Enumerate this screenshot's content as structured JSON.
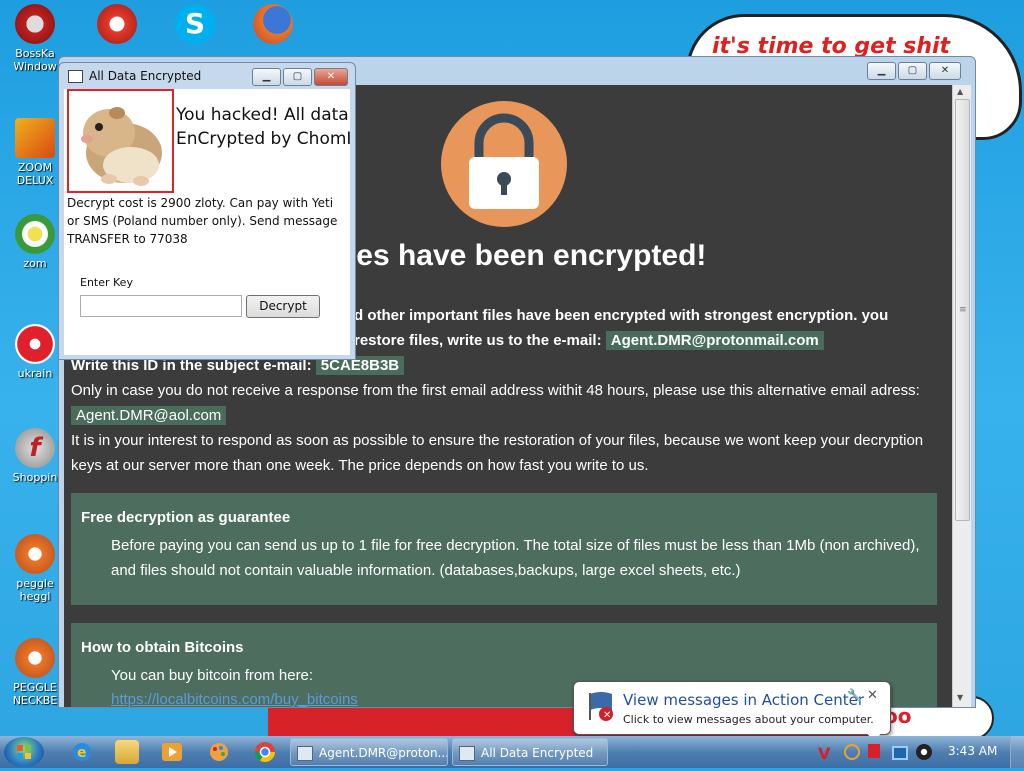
{
  "desktop": {
    "wallpaper_text": "it's time to get shit",
    "wallpaper_text2": "oo",
    "icons": [
      {
        "label_line1": "BossKa",
        "label_line2": "Window"
      },
      {
        "label_line1": "ZOOM",
        "label_line2": "DELUX"
      },
      {
        "label_line1": "zom",
        "label_line2": ""
      },
      {
        "label_line1": "ukrain",
        "label_line2": ""
      },
      {
        "label_line1": "Shoppin",
        "label_line2": ""
      },
      {
        "label_line1": "peggle",
        "label_line2": "heggl"
      },
      {
        "label_line1": "PEGGLE",
        "label_line2": "NECKBE"
      }
    ]
  },
  "main_window": {
    "heading": "r files have been encrypted!",
    "line1": "d other important files have been encrypted with strongest encryption. you",
    "line2_prefix": "restore files, write us to the e-mail:",
    "email_primary": "Agent.DMR@protonmail.com",
    "id_label": "Write this ID in the subject e-mail:",
    "id_value": "5CAE8B3B",
    "line_alt": "Only in case you do not receive a response from the first email address withit 48 hours, please use this alternative email adress:",
    "email_alt": "Agent.DMR@aol.com",
    "line_interest1": "It is in your interest to respond as soon as possible to ensure the restoration of your files, because we wont keep your decryption",
    "line_interest2": "keys at our server more than one week. The price depends on how fast you write to us.",
    "panel1_title": "Free decryption as guarantee",
    "panel1_text1": "Before paying you can send us up to 1 file for free decryption. The total size of files must be less than 1Mb (non archived),",
    "panel1_text2": "and files should not contain valuable information. (databases,backups, large excel sheets, etc.)",
    "panel2_title": "How to obtain Bitcoins",
    "panel2_text": "You can buy bitcoin from here:",
    "panel2_link": "https://localbitcoins.com/buy_bitcoins"
  },
  "dialog": {
    "title": "All Data Encrypted",
    "headline_line1": "You hacked! All data",
    "headline_line2": "EnCrypted by ChomIk",
    "body": "Decrypt cost is 2900 zloty. Can pay with Yeti or SMS (Poland number only). Send message TRANSFER to 77038",
    "key_label": "Enter Key",
    "key_value": "",
    "decrypt_button": "Decrypt"
  },
  "taskbar": {
    "tasks": [
      {
        "label": "Agent.DMR@proton..."
      },
      {
        "label": "All Data Encrypted"
      }
    ],
    "clock": "3:43 AM"
  },
  "notification": {
    "title": "View messages in Action Center",
    "text": "Click to view messages about your computer."
  },
  "colors": {
    "main_bg": "#3c3c3c",
    "lock_circle": "#e8965a",
    "highlight": "#4a6c5a",
    "panel_bg": "#4d6e5e",
    "dialog_border": "#d8262a",
    "link": "#5a9bd8"
  }
}
